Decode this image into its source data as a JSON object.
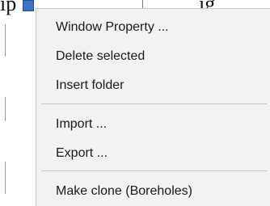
{
  "background": {
    "left_fragment": "ip",
    "right_fragment": "ig"
  },
  "context_menu": {
    "items": [
      {
        "label": "Window Property ..."
      },
      {
        "label": "Delete selected"
      },
      {
        "label": "Insert folder"
      },
      {
        "label": "Import ..."
      },
      {
        "label": "Export ..."
      },
      {
        "label": "Make clone (Boreholes)"
      }
    ]
  },
  "colors": {
    "menu_background": "#f2f2f2",
    "menu_text": "#1a1a1a",
    "separator": "#c9c9c9",
    "tree_icon": "#3a74c7"
  }
}
